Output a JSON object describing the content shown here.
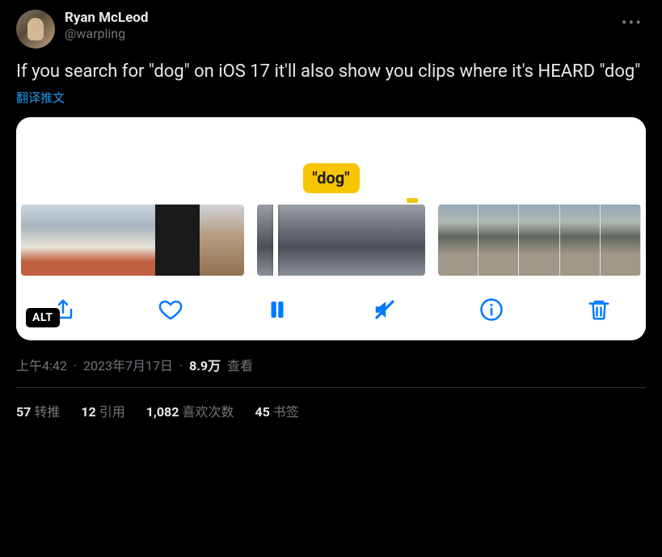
{
  "author": {
    "display_name": "Ryan McLeod",
    "handle": "@warpling"
  },
  "body_text": "If you search for \"dog\" on iOS 17 it'll also show you clips where it's HEARD \"dog\"",
  "translate_label": "翻译推文",
  "media": {
    "chip_label": "\"dog\"",
    "alt_badge": "ALT",
    "toolbar": {
      "share": "share-icon",
      "like": "heart-icon",
      "pause": "pause-icon",
      "mute": "volume-mute-icon",
      "info": "info-icon",
      "delete": "trash-icon"
    }
  },
  "meta": {
    "time": "上午4:42",
    "date": "2023年7月17日",
    "views_num": "8.9万",
    "views_label": "查看"
  },
  "stats": {
    "retweets_num": "57",
    "retweets_label": "转推",
    "quotes_num": "12",
    "quotes_label": "引用",
    "likes_num": "1,082",
    "likes_label": "喜欢次数",
    "bookmarks_num": "45",
    "bookmarks_label": "书签"
  }
}
